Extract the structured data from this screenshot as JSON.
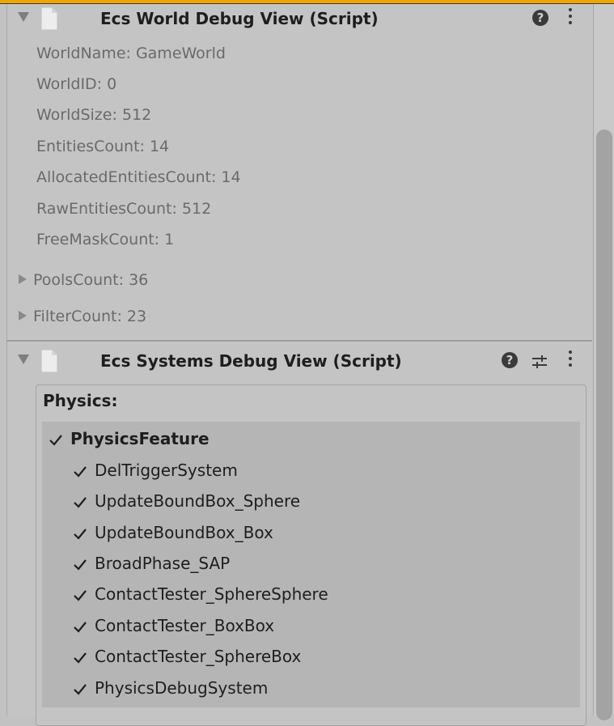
{
  "world_component": {
    "title": "Ecs World Debug View (Script)",
    "fields": [
      "WorldName: GameWorld",
      "WorldID: 0",
      "WorldSize: 512",
      "EntitiesCount: 14",
      "AllocatedEntitiesCount: 14",
      "RawEntitiesCount: 512",
      "FreeMaskCount: 1"
    ],
    "foldouts": [
      "PoolsCount: 36",
      "FilterCount: 23"
    ]
  },
  "systems_component": {
    "title": "Ecs Systems Debug View (Script)",
    "group_title": "Physics:",
    "feature": {
      "label": "PhysicsFeature",
      "checked": true
    },
    "systems": [
      {
        "label": "DelTriggerSystem",
        "checked": true
      },
      {
        "label": "UpdateBoundBox_Sphere",
        "checked": true
      },
      {
        "label": "UpdateBoundBox_Box",
        "checked": true
      },
      {
        "label": "BroadPhase_SAP",
        "checked": true
      },
      {
        "label": "ContactTester_SphereSphere",
        "checked": true
      },
      {
        "label": "ContactTester_BoxBox",
        "checked": true
      },
      {
        "label": "ContactTester_SphereBox",
        "checked": true
      },
      {
        "label": "PhysicsDebugSystem",
        "checked": true
      }
    ]
  },
  "icons": {
    "foldout": "triangle-down-icon",
    "script": "script-file-icon",
    "help": "help-icon",
    "more": "kebab-menu-icon",
    "presets": "presets-sliders-icon",
    "check": "checkmark-icon"
  },
  "colors": {
    "accent_top": "#f0a500",
    "panel_bg": "#c4c4c4",
    "list_bg": "#b5b5b5",
    "disabled_text": "#6a6a6a"
  }
}
